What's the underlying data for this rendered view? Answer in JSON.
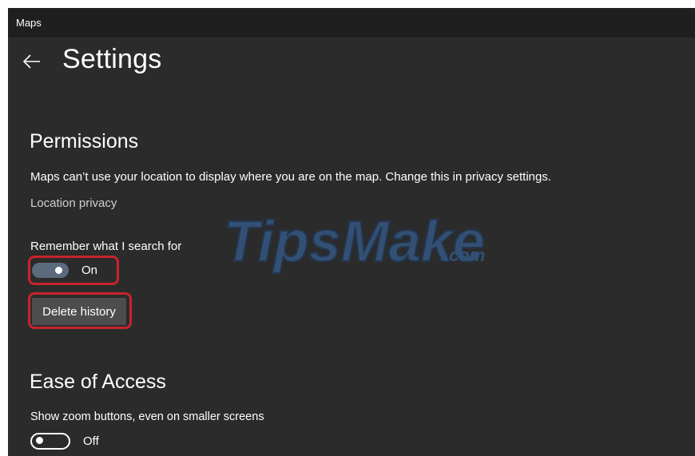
{
  "window": {
    "title": "Maps"
  },
  "header": {
    "back_icon": "back-arrow-icon",
    "title": "Settings"
  },
  "permissions": {
    "title": "Permissions",
    "description": "Maps can’t use your location to display where you are on the map. Change this in privacy settings.",
    "link": "Location privacy",
    "remember_label": "Remember what I search for",
    "remember_state": "On",
    "delete_button": "Delete history"
  },
  "ease_of_access": {
    "title": "Ease of Access",
    "zoom_label": "Show zoom buttons, even on smaller screens",
    "zoom_state": "Off"
  },
  "watermark": {
    "text": "TipsMake",
    "suffix": ".com"
  },
  "colors": {
    "background": "#2b2b2b",
    "titlebar": "#1f1f1f",
    "toggle_on": "#5b6b7d",
    "highlight": "#c8232c",
    "watermark": "#3a6fb0"
  }
}
